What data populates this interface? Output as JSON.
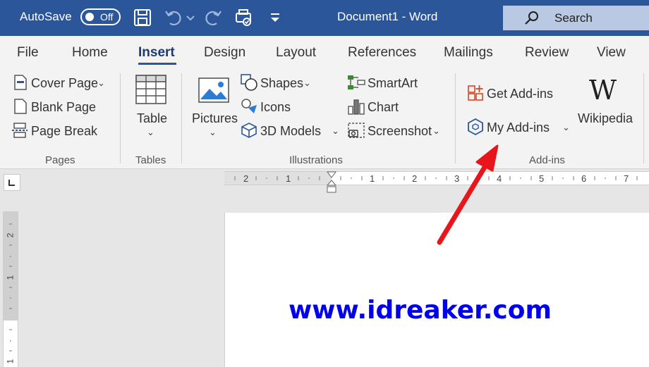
{
  "titlebar": {
    "autosave_label": "AutoSave",
    "autosave_state": "Off",
    "document_title": "Document1  -  Word",
    "search_label": "Search",
    "qat_icons": [
      "save-icon",
      "undo-icon",
      "redo-icon",
      "touch-mode-icon",
      "customize-qat-icon"
    ]
  },
  "tabs": [
    "File",
    "Home",
    "Insert",
    "Design",
    "Layout",
    "References",
    "Mailings",
    "Review",
    "View"
  ],
  "active_tab": "Insert",
  "ribbon": {
    "pages": {
      "group_label": "Pages",
      "cover_page": "Cover Page",
      "blank_page": "Blank Page",
      "page_break": "Page Break"
    },
    "tables": {
      "group_label": "Tables",
      "table": "Table"
    },
    "illustrations": {
      "group_label": "Illustrations",
      "pictures": "Pictures",
      "shapes": "Shapes",
      "icons": "Icons",
      "models_3d": "3D Models",
      "smartart": "SmartArt",
      "chart": "Chart",
      "screenshot": "Screenshot"
    },
    "addins": {
      "group_label": "Add-ins",
      "get_addins": "Get Add-ins",
      "my_addins": "My Add-ins",
      "wikipedia": "Wikipedia",
      "wikipedia_logo": "W"
    }
  },
  "ruler": {
    "labels": [
      "2",
      "1",
      "1",
      "2",
      "3",
      "4",
      "5",
      "6",
      "7"
    ]
  },
  "vruler": {
    "labels": [
      "2",
      "1",
      "1"
    ]
  },
  "document": {
    "watermark": "www.idreaker.com"
  },
  "colors": {
    "titlebar": "#2b579a",
    "ribbon": "#f3f3f3",
    "addin_accent": "#d24726",
    "watermark": "#0000ee",
    "annotation_arrow": "#e8151b"
  }
}
